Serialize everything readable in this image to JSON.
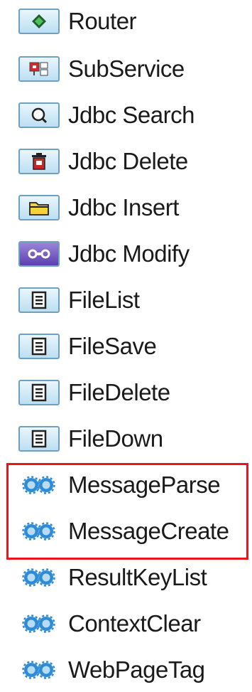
{
  "palette": {
    "items": [
      {
        "label": "Router",
        "icon": "router-icon"
      },
      {
        "label": "SubService",
        "icon": "subservice-icon"
      },
      {
        "label": "Jdbc Search",
        "icon": "search-icon"
      },
      {
        "label": "Jdbc Delete",
        "icon": "trash-icon"
      },
      {
        "label": "Jdbc Insert",
        "icon": "folder-icon"
      },
      {
        "label": "Jdbc Modify",
        "icon": "modify-icon"
      },
      {
        "label": "FileList",
        "icon": "file-icon"
      },
      {
        "label": "FileSave",
        "icon": "file-icon"
      },
      {
        "label": "FileDelete",
        "icon": "file-icon"
      },
      {
        "label": "FileDown",
        "icon": "file-icon"
      },
      {
        "label": "MessageParse",
        "icon": "gear-icon"
      },
      {
        "label": "MessageCreate",
        "icon": "gear-icon"
      },
      {
        "label": "ResultKeyList",
        "icon": "gear-icon"
      },
      {
        "label": "ContextClear",
        "icon": "gear-icon"
      },
      {
        "label": "WebPageTag",
        "icon": "gear-icon"
      }
    ]
  },
  "highlight_color": "#e8141e"
}
